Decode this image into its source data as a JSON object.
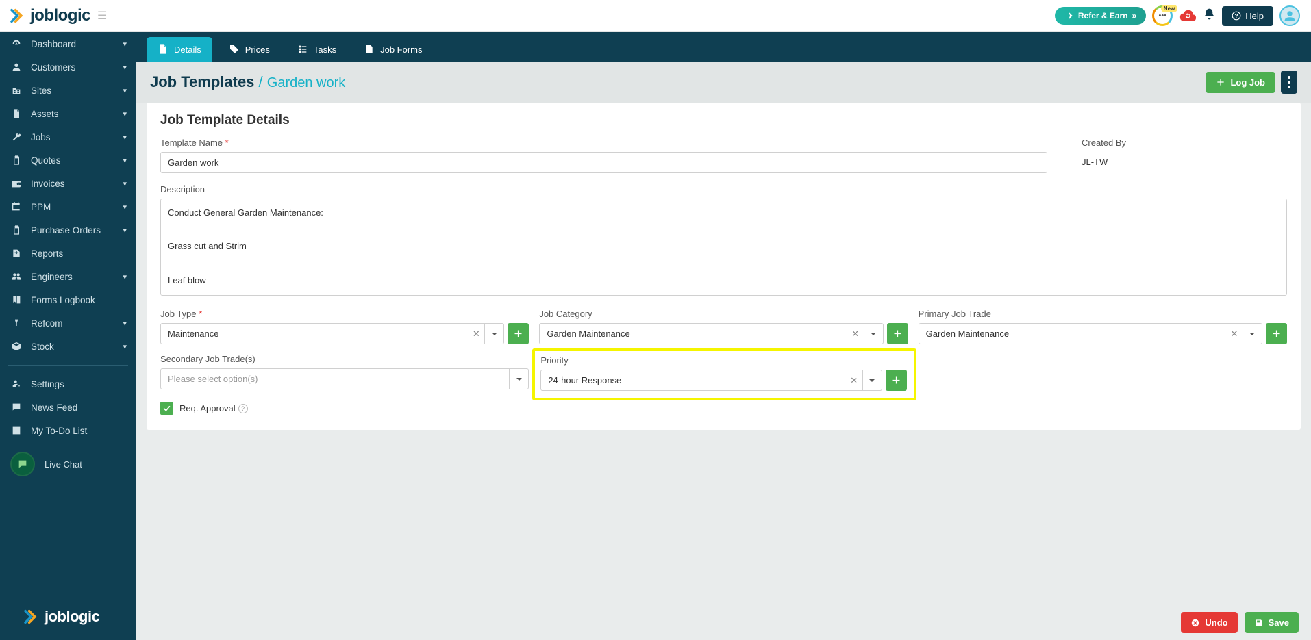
{
  "app": {
    "name": "joblogic"
  },
  "topbar": {
    "refer_label": "Refer & Earn",
    "new_badge": "New",
    "help_label": "Help"
  },
  "sidebar": {
    "items": [
      {
        "label": "Dashboard",
        "icon": "gauge",
        "chev": true
      },
      {
        "label": "Customers",
        "icon": "user",
        "chev": true
      },
      {
        "label": "Sites",
        "icon": "building",
        "chev": true
      },
      {
        "label": "Assets",
        "icon": "doc",
        "chev": true
      },
      {
        "label": "Jobs",
        "icon": "wrench",
        "chev": true
      },
      {
        "label": "Quotes",
        "icon": "clipboard",
        "chev": true
      },
      {
        "label": "Invoices",
        "icon": "wallet",
        "chev": true
      },
      {
        "label": "PPM",
        "icon": "calendar",
        "chev": true
      },
      {
        "label": "Purchase Orders",
        "icon": "clipboard",
        "chev": true
      },
      {
        "label": "Reports",
        "icon": "export",
        "chev": false
      },
      {
        "label": "Engineers",
        "icon": "group",
        "chev": true
      },
      {
        "label": "Forms Logbook",
        "icon": "book",
        "chev": false
      },
      {
        "label": "Refcom",
        "icon": "bar",
        "chev": true
      },
      {
        "label": "Stock",
        "icon": "box",
        "chev": true
      }
    ],
    "secondary": [
      {
        "label": "Settings",
        "icon": "user-cog"
      },
      {
        "label": "News Feed",
        "icon": "feed"
      },
      {
        "label": "My To-Do List",
        "icon": "checklist"
      }
    ],
    "chat_label": "Live Chat"
  },
  "tabs": [
    {
      "label": "Details",
      "icon": "doc",
      "active": true
    },
    {
      "label": "Prices",
      "icon": "tag",
      "active": false
    },
    {
      "label": "Tasks",
      "icon": "tasks",
      "active": false
    },
    {
      "label": "Job Forms",
      "icon": "form",
      "active": false
    }
  ],
  "header": {
    "title": "Job Templates",
    "sub": "Garden work",
    "logjob_label": "Log Job"
  },
  "form": {
    "section_title": "Job Template Details",
    "labels": {
      "template_name": "Template Name",
      "created_by": "Created By",
      "description": "Description",
      "job_type": "Job Type",
      "job_category": "Job Category",
      "primary_trade": "Primary Job Trade",
      "secondary_trade": "Secondary Job Trade(s)",
      "priority": "Priority",
      "req_approval": "Req. Approval"
    },
    "values": {
      "template_name": "Garden work",
      "created_by": "JL-TW",
      "description": "Conduct General Garden Maintenance:\n\nGrass cut and Strim\n\nLeaf blow\n\nLitter pick and weeding",
      "job_type": "Maintenance",
      "job_category": "Garden Maintenance",
      "primary_trade": "Garden Maintenance",
      "secondary_trade": "",
      "secondary_trade_placeholder": "Please select option(s)",
      "priority": "24-hour Response",
      "req_approval": true
    }
  },
  "footer": {
    "undo_label": "Undo",
    "save_label": "Save"
  }
}
